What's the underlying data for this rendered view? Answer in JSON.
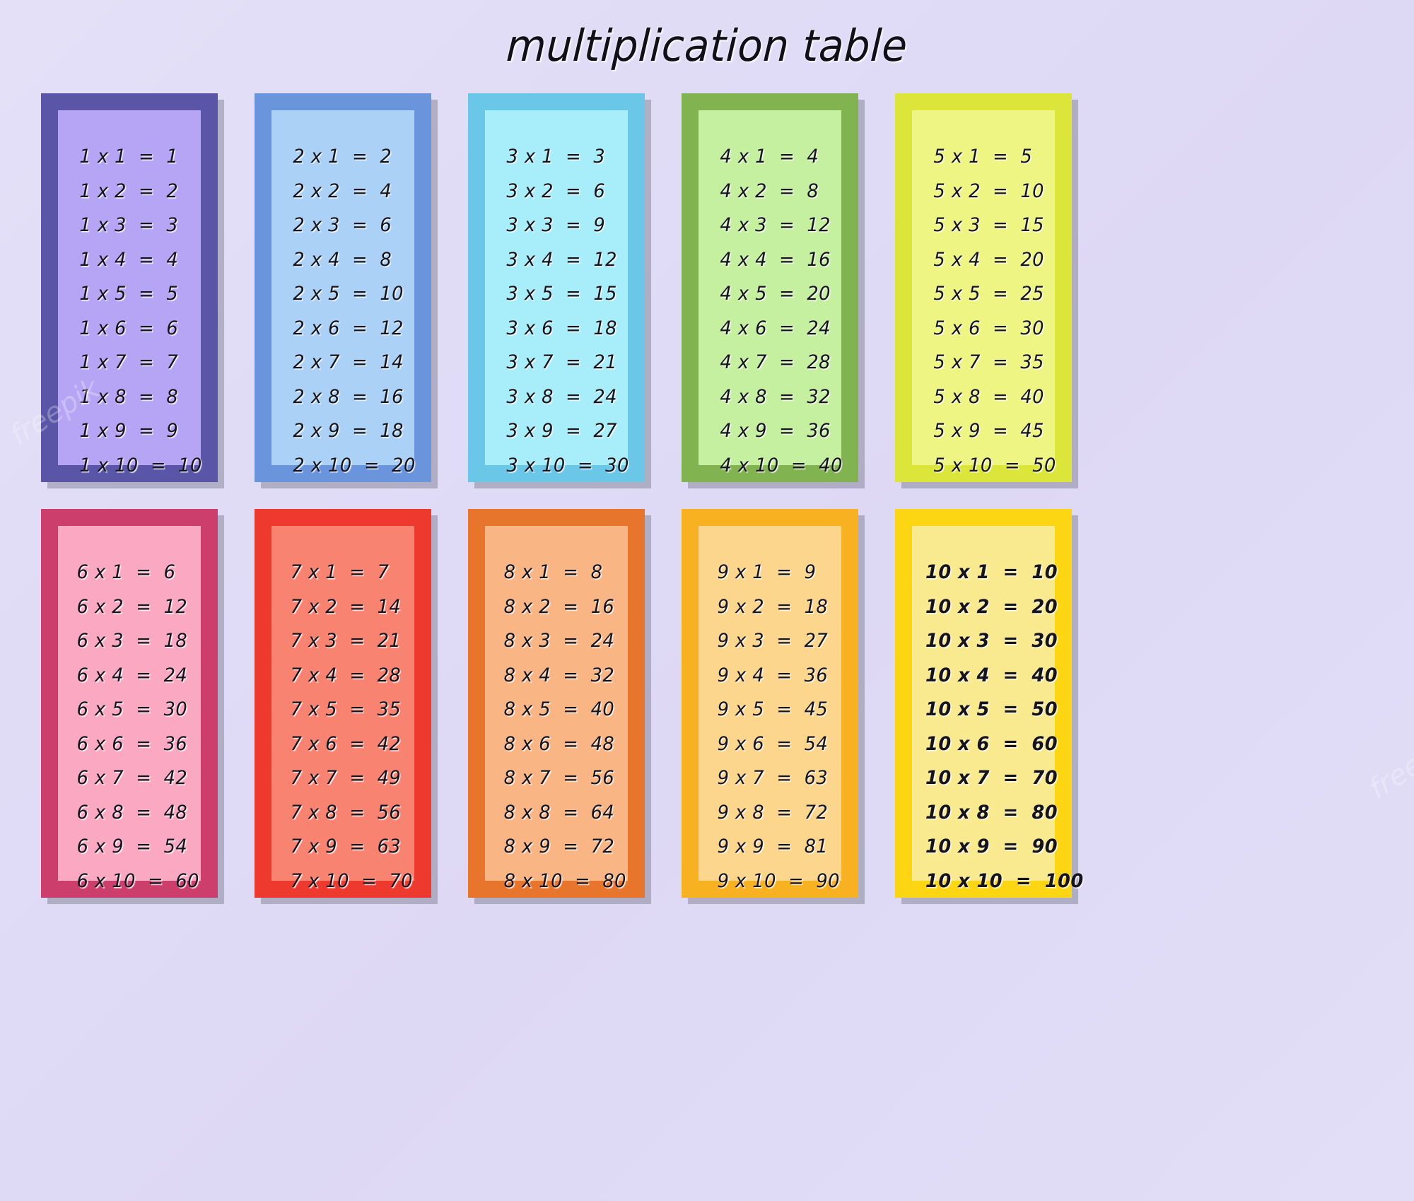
{
  "page": {
    "title": "multiplication table",
    "background_color": "#e1ddf6",
    "text_color": "#15131c",
    "watermark_text": "freepik"
  },
  "cards": [
    {
      "id": "table-1",
      "factor": 1,
      "frame_color": "#5b55a8",
      "panel_color": "#b6a5f5",
      "rows": [
        "1 x 1  =  1",
        "1 x 2  =  2",
        "1 x 3  =  3",
        "1 x 4  =  4",
        "1 x 5  =  5",
        "1 x 6  =  6",
        "1 x 7  =  7",
        "1 x 8  =  8",
        "1 x 9  =  9",
        "1 x 10  =  10"
      ]
    },
    {
      "id": "table-2",
      "factor": 2,
      "frame_color": "#6a94dc",
      "panel_color": "#abd1f7",
      "rows": [
        "2 x 1  =  2",
        "2 x 2  =  4",
        "2 x 3  =  6",
        "2 x 4  =  8",
        "2 x 5  =  10",
        "2 x 6  =  12",
        "2 x 7  =  14",
        "2 x 8  =  16",
        "2 x 9  =  18",
        "2 x 10  =  20"
      ]
    },
    {
      "id": "table-3",
      "factor": 3,
      "frame_color": "#6bc7e8",
      "panel_color": "#a8edfa",
      "rows": [
        "3 x 1  =  3",
        "3 x 2  =  6",
        "3 x 3  =  9",
        "3 x 4  =  12",
        "3 x 5  =  15",
        "3 x 6  =  18",
        "3 x 7  =  21",
        "3 x 8  =  24",
        "3 x 9  =  27",
        "3 x 10  =  30"
      ]
    },
    {
      "id": "table-4",
      "factor": 4,
      "frame_color": "#81b351",
      "panel_color": "#c5f0a0",
      "rows": [
        "4 x 1  =  4",
        "4 x 2  =  8",
        "4 x 3  =  12",
        "4 x 4  =  16",
        "4 x 5  =  20",
        "4 x 6  =  24",
        "4 x 7  =  28",
        "4 x 8  =  32",
        "4 x 9  =  36",
        "4 x 10  =  40"
      ]
    },
    {
      "id": "table-5",
      "factor": 5,
      "frame_color": "#dce53a",
      "panel_color": "#eff583",
      "rows": [
        "5 x 1  =  5",
        "5 x 2  =  10",
        "5 x 3  =  15",
        "5 x 4  =  20",
        "5 x 5  =  25",
        "5 x 6  =  30",
        "5 x 7  =  35",
        "5 x 8  =  40",
        "5 x 9  =  45",
        "5 x 10  =  50"
      ]
    },
    {
      "id": "table-6",
      "factor": 6,
      "frame_color": "#cc3e6c",
      "panel_color": "#fba9c3",
      "rows": [
        "6 x 1  =  6",
        "6 x 2  =  12",
        "6 x 3  =  18",
        "6 x 4  =  24",
        "6 x 5  =  30",
        "6 x 6  =  36",
        "6 x 7  =  42",
        "6 x 8  =  48",
        "6 x 9  =  54",
        "6 x 10  =  60"
      ]
    },
    {
      "id": "table-7",
      "factor": 7,
      "frame_color": "#ee3a2e",
      "panel_color": "#f98371",
      "rows": [
        "7 x 1  =  7",
        "7 x 2  =  14",
        "7 x 3  =  21",
        "7 x 4  =  28",
        "7 x 5  =  35",
        "7 x 6  =  42",
        "7 x 7  =  49",
        "7 x 8  =  56",
        "7 x 9  =  63",
        "7 x 10  =  70"
      ]
    },
    {
      "id": "table-8",
      "factor": 8,
      "frame_color": "#e8752c",
      "panel_color": "#f9b684",
      "rows": [
        "8 x 1  =  8",
        "8 x 2  =  16",
        "8 x 3  =  24",
        "8 x 4  =  32",
        "8 x 5  =  40",
        "8 x 6  =  48",
        "8 x 7  =  56",
        "8 x 8  =  64",
        "8 x 9  =  72",
        "8 x 10  =  80"
      ]
    },
    {
      "id": "table-9",
      "factor": 9,
      "frame_color": "#f8b121",
      "panel_color": "#fcd68c",
      "rows": [
        "9 x 1  =  9",
        "9 x 2  =  18",
        "9 x 3  =  27",
        "9 x 4  =  36",
        "9 x 5  =  45",
        "9 x 6  =  54",
        "9 x 7  =  63",
        "9 x 8  =  72",
        "9 x 9  =  81",
        "9 x 10  =  90"
      ]
    },
    {
      "id": "table-10",
      "factor": 10,
      "frame_color": "#fcd513",
      "panel_color": "#faea8f",
      "bold": true,
      "rows": [
        "10 x 1  =  10",
        "10 x 2  =  20",
        "10 x 3  =  30",
        "10 x 4  =  40",
        "10 x 5  =  50",
        "10 x 6  =  60",
        "10 x 7  =  70",
        "10 x 8  =  80",
        "10 x 9  =  90",
        "10 x 10  =  100"
      ]
    }
  ]
}
